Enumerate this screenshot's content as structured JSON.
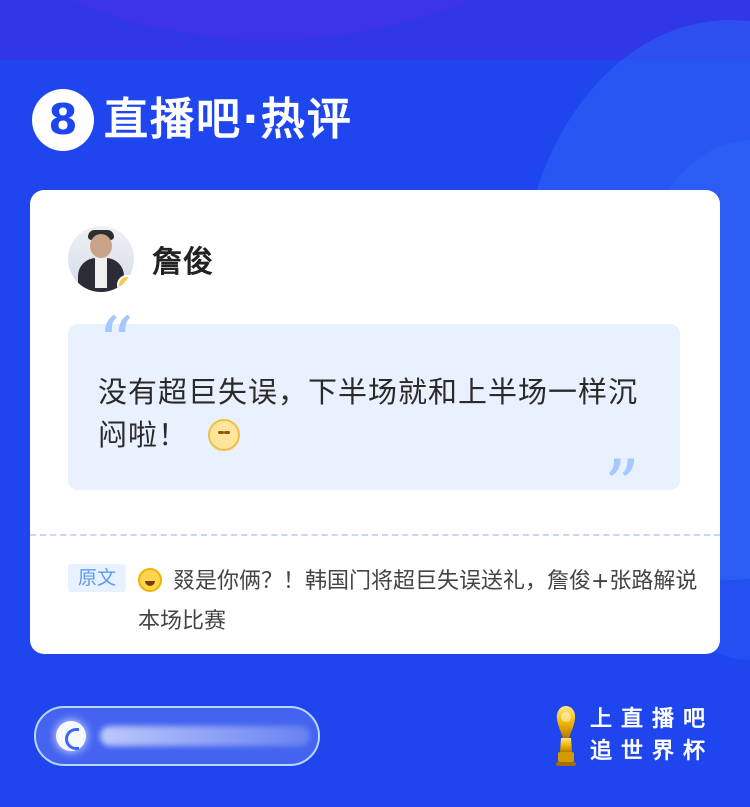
{
  "brand": {
    "badge": "8",
    "title": "直播吧·热评"
  },
  "post": {
    "author": "詹俊",
    "quote_text": "没有超巨失误，下半场就和上半场一样沉闷啦！",
    "open_quote": "“",
    "close_quote": "”"
  },
  "source": {
    "tag": "原文",
    "text": "叕是你俩？！韩国门将超巨失误送礼，詹俊+张路解说本场比赛"
  },
  "promo": {
    "line1": "上直播吧",
    "line2": "追世界杯"
  },
  "icons": {
    "avatar": "avatar",
    "verified": "verified-badge-icon",
    "emoji_in_quote": "grinning-cat-emoji-icon",
    "emoji_in_source": "laughing-emoji-icon",
    "input": "c-app-icon",
    "trophy": "trophy-icon"
  },
  "colors": {
    "primary_blue": "#1f46ee",
    "quote_bg": "#e9f0fe",
    "quote_mark": "#a5c8ff",
    "tag_bg": "#e8f1ff",
    "tag_text": "#5f9aee"
  }
}
